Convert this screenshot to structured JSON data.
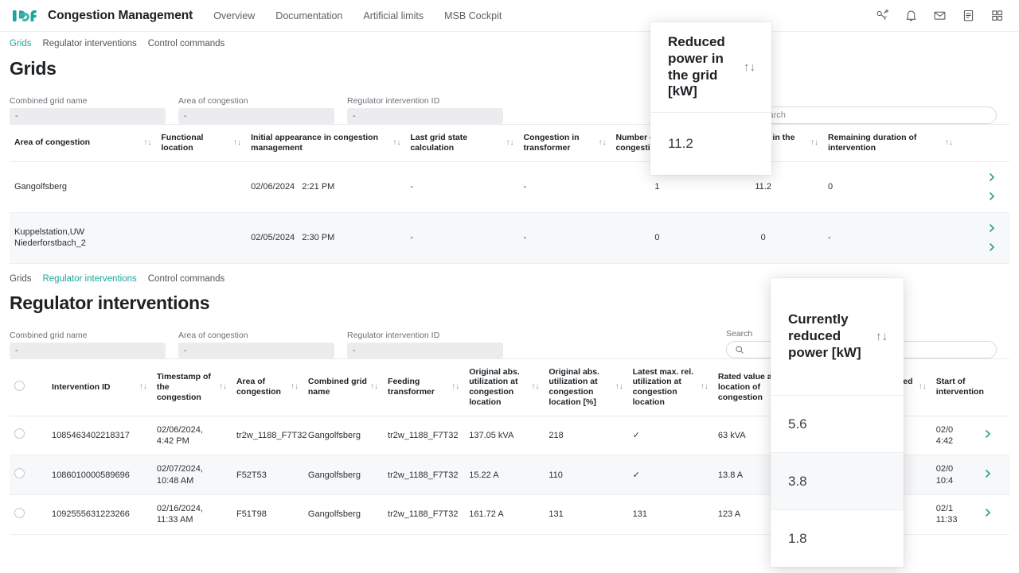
{
  "topnav": {
    "logo_text": "ICF",
    "app_title": "Congestion Management",
    "links": [
      {
        "label": "Overview"
      },
      {
        "label": "Documentation"
      },
      {
        "label": "Artificial limits"
      },
      {
        "label": "MSB Cockpit"
      }
    ],
    "icons": [
      {
        "name": "plug-connection-icon"
      },
      {
        "name": "bell-icon"
      },
      {
        "name": "mail-icon"
      },
      {
        "name": "document-icon"
      },
      {
        "name": "apps-grid-icon"
      }
    ]
  },
  "grids_section": {
    "tabs": [
      {
        "label": "Grids",
        "active": true
      },
      {
        "label": "Regulator interventions",
        "active": false
      },
      {
        "label": "Control commands",
        "active": false
      }
    ],
    "title": "Grids",
    "filters": [
      {
        "label": "Combined grid name",
        "value": "-"
      },
      {
        "label": "Area of congestion",
        "value": "-"
      },
      {
        "label": "Regulator intervention ID",
        "value": "-"
      }
    ],
    "search": {
      "label": "Search",
      "placeholder": "Search",
      "value": ""
    },
    "columns": [
      {
        "label": "Area of congestion",
        "sortable": true
      },
      {
        "label": "Functional location",
        "sortable": true
      },
      {
        "label": "Initial appearance in congestion management",
        "sortable": true
      },
      {
        "label": "Last grid state calculation",
        "sortable": true
      },
      {
        "label": "Congestion in transformer",
        "sortable": true
      },
      {
        "label": "Number of congestions",
        "sortable": true
      },
      {
        "label": "Reduced power in the grid [kW]",
        "sortable": true
      },
      {
        "label": "Remaining duration of intervention",
        "sortable": true
      },
      {
        "label": "",
        "sortable": false
      }
    ],
    "rows": [
      {
        "area_of_congestion": "Gangolfsberg",
        "functional_location": "",
        "initial_appearance_date": "02/06/2024",
        "initial_appearance_time": "2:21 PM",
        "last_grid_state_calculation": "-",
        "congestion_in_transformer": "-",
        "number_of_congestions": "1",
        "reduced_power": "11.2",
        "remaining_duration": "0"
      },
      {
        "area_of_congestion": "Kuppelstation,UW Niederforstbach_2",
        "functional_location": "",
        "initial_appearance_date": "02/05/2024",
        "initial_appearance_time": "2:30 PM",
        "last_grid_state_calculation": "-",
        "congestion_in_transformer": "-",
        "number_of_congestions": "0",
        "reduced_power": "0",
        "remaining_duration": "-"
      }
    ]
  },
  "interventions_section": {
    "tabs": [
      {
        "label": "Grids",
        "active": false
      },
      {
        "label": "Regulator interventions",
        "active": true
      },
      {
        "label": "Control commands",
        "active": false
      }
    ],
    "title": "Regulator interventions",
    "filters": [
      {
        "label": "Combined grid name",
        "value": "-"
      },
      {
        "label": "Area of congestion",
        "value": "-"
      },
      {
        "label": "Regulator intervention ID",
        "value": "-"
      }
    ],
    "search": {
      "label": "Search",
      "placeholder": "",
      "value": ""
    },
    "columns": [
      {
        "label": "",
        "sortable": false
      },
      {
        "label": "Intervention ID",
        "sortable": true
      },
      {
        "label": "Timestamp of the congestion",
        "sortable": true
      },
      {
        "label": "Area of congestion",
        "sortable": true
      },
      {
        "label": "Combined grid name",
        "sortable": true
      },
      {
        "label": "Feeding transformer",
        "sortable": true
      },
      {
        "label": "Original abs. utilization at congestion location",
        "sortable": true
      },
      {
        "label": "Original abs. utilization at congestion location [%]",
        "sortable": true
      },
      {
        "label": "Latest max. rel. utilization at congestion location",
        "sortable": true
      },
      {
        "label": "Rated value at location of congestion",
        "sortable": false
      },
      {
        "label": "Currently reduced power [kW]",
        "sortable": true
      },
      {
        "label": "Controlled source",
        "sortable": true
      },
      {
        "label": "Start of intervention",
        "sortable": false
      },
      {
        "label": "",
        "sortable": false
      }
    ],
    "rows": [
      {
        "intervention_id": "1085463402218317",
        "timestamp_date": "02/06/2024,",
        "timestamp_time": "4:42 PM",
        "area_of_congestion": "tr2w_1188_F7T32",
        "combined_grid_name": "Gangolfsberg",
        "feeding_transformer": "tr2w_1188_F7T32",
        "original_abs_utilization": "137.05 kVA",
        "original_abs_utilization_pct": "218",
        "latest_max_rel_utilization": "check",
        "rated_value": "63 kVA",
        "currently_reduced_power": "5.6",
        "start_date": "02/0",
        "start_time": "4:42"
      },
      {
        "intervention_id": "1086010000589696",
        "timestamp_date": "02/07/2024,",
        "timestamp_time": "10:48 AM",
        "area_of_congestion": "F52T53",
        "combined_grid_name": "Gangolfsberg",
        "feeding_transformer": "tr2w_1188_F7T32",
        "original_abs_utilization": "15.22 A",
        "original_abs_utilization_pct": "110",
        "latest_max_rel_utilization": "check",
        "rated_value": "13.8 A",
        "currently_reduced_power": "3.8",
        "start_date": "02/0",
        "start_time": "10:4"
      },
      {
        "intervention_id": "1092555631223266",
        "timestamp_date": "02/16/2024,",
        "timestamp_time": "11:33 AM",
        "area_of_congestion": "F51T98",
        "combined_grid_name": "Gangolfsberg",
        "feeding_transformer": "tr2w_1188_F7T32",
        "original_abs_utilization": "161.72 A",
        "original_abs_utilization_pct": "131",
        "latest_max_rel_utilization": "131",
        "rated_value": "123 A",
        "currently_reduced_power": "1.8",
        "start_date": "02/1",
        "start_time": "11:33"
      }
    ]
  },
  "popups": [
    {
      "id": "reduced-power",
      "title": "Reduced power in the grid [kW]",
      "sort_icon": "sort-icon",
      "cells": [
        "11.2"
      ]
    },
    {
      "id": "current-power",
      "title": "Currently reduced power [kW]",
      "sort_icon": "sort-icon",
      "cells": [
        "5.6",
        "3.8",
        "1.8"
      ]
    }
  ],
  "colors": {
    "accent_teal": "#1aa79a",
    "chevron_green": "#2f9e87",
    "alert_red": "#d3325c",
    "text_primary": "#1d2125",
    "text_muted": "#6b7177",
    "row_alt": "#f7f8f9",
    "field_bg": "#ececee"
  },
  "glyphs": {
    "sort": "↑↓",
    "check": "✓",
    "chevron_right": "›"
  }
}
